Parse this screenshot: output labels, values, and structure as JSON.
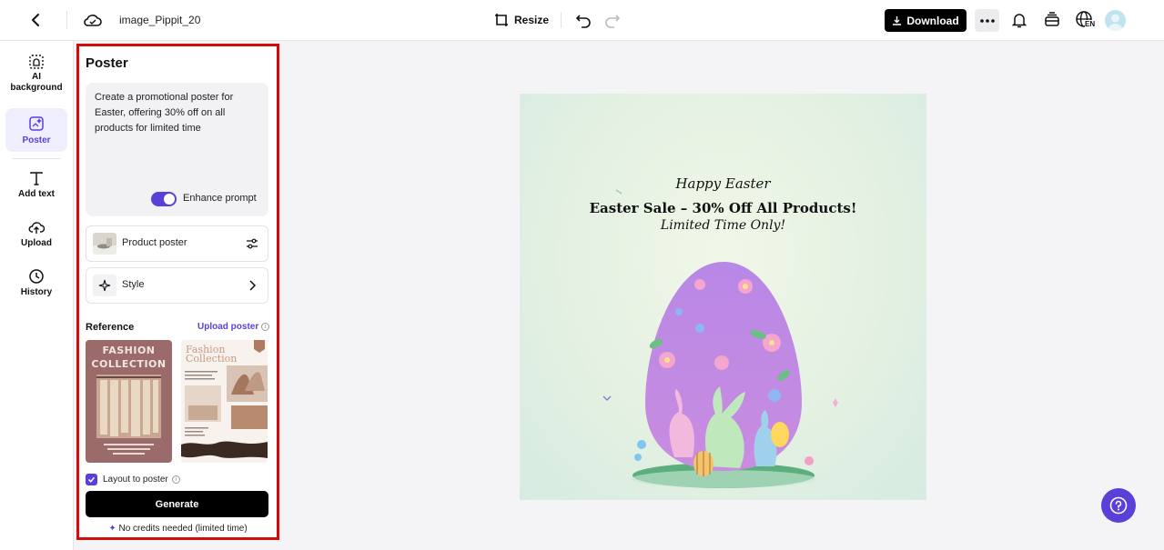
{
  "header": {
    "file_name": "image_Pippit_20",
    "resize_label": "Resize",
    "download_label": "Download",
    "language_badge": "EN"
  },
  "nav": {
    "items": [
      {
        "label": "AI background",
        "icon": "ai-background-icon"
      },
      {
        "label": "Poster",
        "icon": "poster-icon",
        "active": true
      },
      {
        "label": "Add text",
        "icon": "text-icon"
      },
      {
        "label": "Upload",
        "icon": "upload-icon"
      },
      {
        "label": "History",
        "icon": "history-icon"
      }
    ]
  },
  "panel": {
    "title": "Poster",
    "prompt": "Create a promotional poster for Easter, offering 30% off on all products for limited time",
    "enhance_label": "Enhance prompt",
    "enhance_on": true,
    "product_label": "Product poster",
    "style_label": "Style",
    "reference_label": "Reference",
    "upload_poster_label": "Upload poster",
    "ref1_title": "FASHION COLLECTION",
    "ref2_title": "Fashion Collection",
    "layout_label": "Layout to poster",
    "layout_checked": true,
    "generate_label": "Generate",
    "credits_text": "No credits needed (limited time)"
  },
  "poster": {
    "line1": "Happy Easter",
    "line2": "Easter Sale – 30% Off All Products!",
    "line3": "Limited Time Only!"
  },
  "colors": {
    "accent": "#5b3fd9",
    "highlight_border": "#d40b0b"
  }
}
